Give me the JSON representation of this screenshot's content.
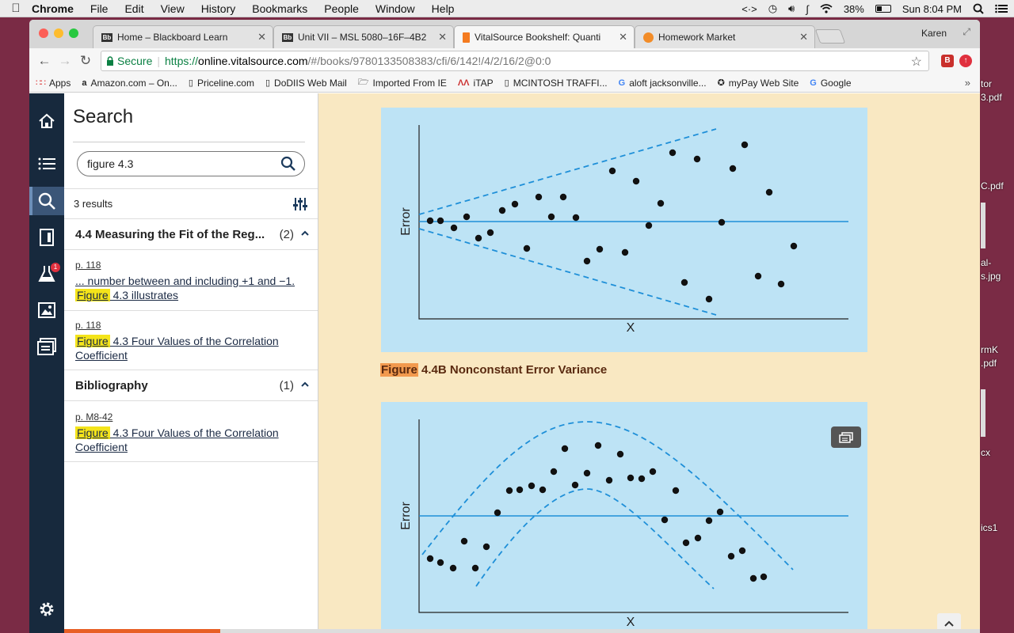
{
  "menubar": {
    "items": [
      "Chrome",
      "File",
      "Edit",
      "View",
      "History",
      "Bookmarks",
      "People",
      "Window",
      "Help"
    ],
    "battery": "38%",
    "clock": "Sun 8:04 PM"
  },
  "browser": {
    "tabs": [
      {
        "favicon": "Bb",
        "title": "Home – Blackboard Learn"
      },
      {
        "favicon": "Bb",
        "title": "Unit VII – MSL 5080–16F–4B2"
      },
      {
        "favicon": "vs",
        "title": "VitalSource Bookshelf: Quanti"
      },
      {
        "favicon": "hm",
        "title": "Homework Market"
      }
    ],
    "active_tab": 2,
    "profile": "Karen",
    "address": {
      "secure_label": "Secure",
      "scheme": "https://",
      "host": "online.vitalsource.com",
      "path": "/#/books/9780133508383/cfi/6/142!/4/2/16/2@0:0"
    },
    "bookmarks": [
      {
        "icon": "apps-grid-icon",
        "label": "Apps"
      },
      {
        "icon": "amazon-icon",
        "label": "Amazon.com – On..."
      },
      {
        "icon": "page-icon",
        "label": "Priceline.com"
      },
      {
        "icon": "page-icon",
        "label": "DoDIIS Web Mail"
      },
      {
        "icon": "folder-icon",
        "label": "Imported From IE"
      },
      {
        "icon": "itap-icon",
        "label": "iTAP"
      },
      {
        "icon": "page-icon",
        "label": "MCINTOSH TRAFFI..."
      },
      {
        "icon": "google-icon",
        "label": "aloft jacksonville..."
      },
      {
        "icon": "mypay-icon",
        "label": "myPay Web Site"
      },
      {
        "icon": "google-icon",
        "label": "Google"
      }
    ]
  },
  "desktop": {
    "labels": [
      "tor",
      "3.pdf",
      "C.pdf",
      "al-",
      "s.jpg",
      "rmK",
      ".pdf",
      "cx",
      "ics1"
    ]
  },
  "rail": {
    "notification_badge": "1"
  },
  "search": {
    "title": "Search",
    "query": "figure 4.3",
    "results_count": "3 results",
    "sections": [
      {
        "title": "4.4 Measuring the Fit of the Reg...",
        "count": "(2)",
        "results": [
          {
            "page": "p. 118",
            "before": "... number between and including +1 and −1.",
            "highlight": "Figure",
            "after": " 4.3 illustrates"
          },
          {
            "page": "p. 118",
            "before": "",
            "highlight": "Figure",
            "after": " 4.3 Four Values of the Correlation Coefficient"
          }
        ]
      },
      {
        "title": "Bibliography",
        "count": "(1)",
        "results": [
          {
            "page": "p. M8-42",
            "before": "",
            "highlight": "Figure",
            "after": " 4.3 Four Values of the Correlation Coefficient"
          }
        ]
      }
    ]
  },
  "reader": {
    "caption_highlight": "Figure",
    "caption_rest": " 4.4B Nonconstant Error Variance",
    "reading_progress": 0.17,
    "figures": [
      {
        "ylabel": "Error",
        "xlabel": "X",
        "points": [
          [
            543,
            279
          ],
          [
            556,
            279
          ],
          [
            573,
            288
          ],
          [
            589,
            274
          ],
          [
            604,
            301
          ],
          [
            619,
            294
          ],
          [
            634,
            266
          ],
          [
            650,
            258
          ],
          [
            665,
            314
          ],
          [
            680,
            249
          ],
          [
            696,
            274
          ],
          [
            711,
            249
          ],
          [
            727,
            275
          ],
          [
            741,
            330
          ],
          [
            757,
            315
          ],
          [
            773,
            216
          ],
          [
            789,
            319
          ],
          [
            803,
            229
          ],
          [
            819,
            285
          ],
          [
            834,
            257
          ],
          [
            849,
            193
          ],
          [
            864,
            357
          ],
          [
            880,
            201
          ],
          [
            895,
            378
          ],
          [
            911,
            281
          ],
          [
            925,
            213
          ],
          [
            940,
            183
          ],
          [
            957,
            349
          ],
          [
            971,
            243
          ],
          [
            986,
            359
          ],
          [
            1002,
            311
          ]
        ]
      },
      {
        "ylabel": "Error",
        "xlabel": "X",
        "points": [
          [
            543,
            706
          ],
          [
            556,
            711
          ],
          [
            572,
            718
          ],
          [
            586,
            684
          ],
          [
            600,
            718
          ],
          [
            614,
            691
          ],
          [
            628,
            648
          ],
          [
            643,
            620
          ],
          [
            656,
            619
          ],
          [
            671,
            614
          ],
          [
            685,
            619
          ],
          [
            699,
            596
          ],
          [
            713,
            567
          ],
          [
            726,
            613
          ],
          [
            741,
            598
          ],
          [
            755,
            563
          ],
          [
            769,
            607
          ],
          [
            783,
            574
          ],
          [
            796,
            604
          ],
          [
            810,
            605
          ],
          [
            824,
            596
          ],
          [
            839,
            657
          ],
          [
            853,
            620
          ],
          [
            866,
            686
          ],
          [
            881,
            680
          ],
          [
            895,
            658
          ],
          [
            909,
            647
          ],
          [
            923,
            703
          ],
          [
            937,
            696
          ],
          [
            951,
            731
          ],
          [
            964,
            729
          ]
        ]
      }
    ]
  }
}
